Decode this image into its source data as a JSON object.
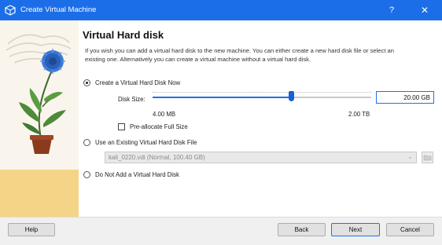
{
  "window": {
    "title": "Create Virtual Machine",
    "help_glyph": "?",
    "close_glyph": "✕"
  },
  "page": {
    "heading": "Virtual Hard disk",
    "description": "If you wish you can add a virtual hard disk to the new machine. You can either create a new hard disk file or select an existing one. Alternatively you can create a virtual machine without a virtual hard disk."
  },
  "options": {
    "create_now": {
      "label": "Create a Virtual Hard Disk Now",
      "selected": true
    },
    "use_existing": {
      "label": "Use an Existing Virtual Hard Disk File",
      "selected": false
    },
    "no_disk": {
      "label": "Do Not Add a Virtual Hard Disk",
      "selected": false
    }
  },
  "disk_size": {
    "label": "Disk Size:",
    "value": "20.00 GB",
    "min_label": "4.00 MB",
    "max_label": "2.00 TB",
    "slider_fraction": 0.64
  },
  "preallocate": {
    "label": "Pre-allocate Full Size",
    "checked": false
  },
  "existing_file": {
    "value": "kali_0220.vdi (Normal, 100.40 GB)",
    "enabled": false
  },
  "buttons": {
    "help": "Help",
    "back": "Back",
    "next": "Next",
    "cancel": "Cancel"
  },
  "colors": {
    "titlebar": "#1c6ee8",
    "accent": "#1a73e8"
  },
  "icons": {
    "app": "virtualbox-icon",
    "folder": "folder-icon"
  }
}
